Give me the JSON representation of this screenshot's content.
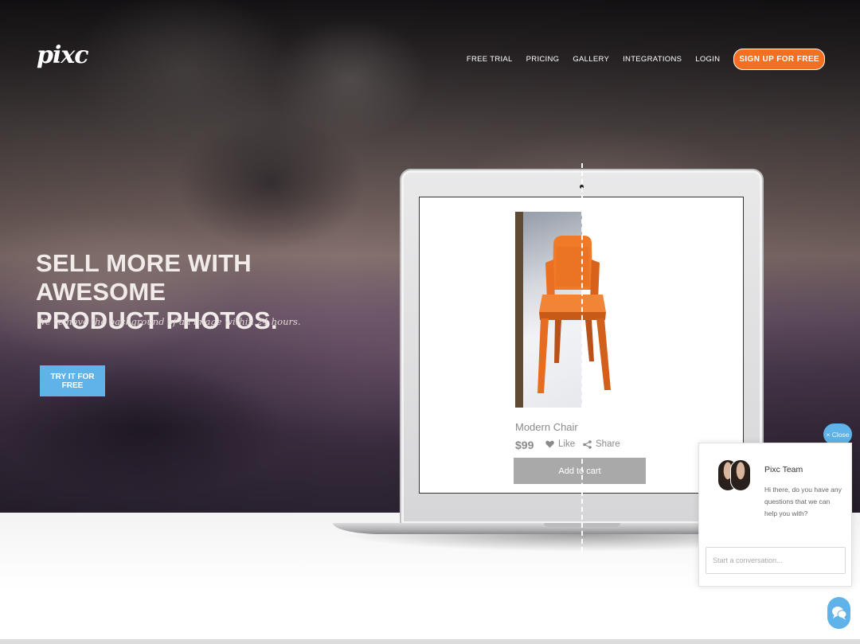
{
  "brand": {
    "logo": "pixc"
  },
  "nav": {
    "links": [
      "FREE TRIAL",
      "PRICING",
      "GALLERY",
      "INTEGRATIONS",
      "LOGIN"
    ],
    "signup": "SIGN UP FOR FREE",
    "accent_color": "#f36f21"
  },
  "hero": {
    "headline_line1": "SELL MORE WITH AWESOME",
    "headline_line2": "PRODUCT PHOTOS.",
    "subline": "We remove the background of an image within 24 hours.",
    "cta": "TRY IT FOR FREE",
    "cta_color": "#5fb3e8"
  },
  "product": {
    "name": "Modern Chair",
    "price": "$99",
    "like": "Like",
    "share": "Share",
    "add_to_cart": "Add to cart"
  },
  "chat": {
    "close": "× Close",
    "team": "Pixc Team",
    "message": "Hi there, do you have any questions that we can help you with?",
    "input_placeholder": "Start a conversation...",
    "icons": [
      "chat-bubbles-icon",
      "close-icon"
    ]
  }
}
